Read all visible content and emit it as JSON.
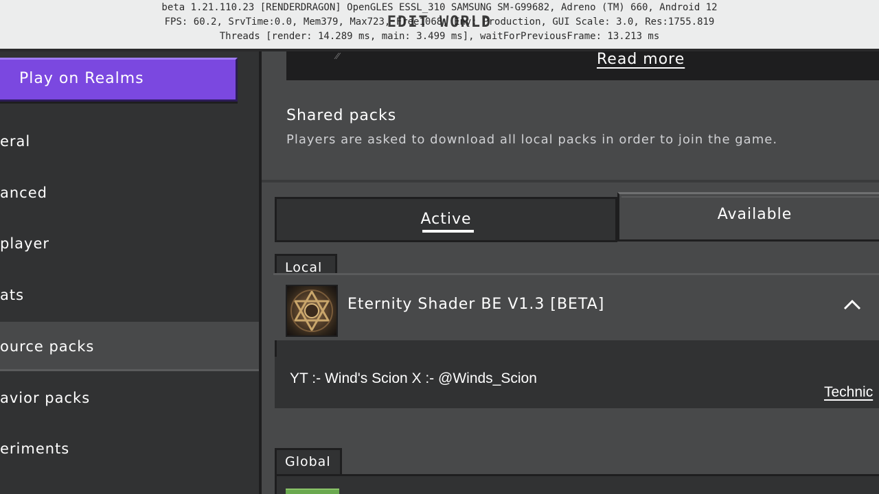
{
  "debug": {
    "line1": "beta 1.21.110.23 [RENDERDRAGON] OpenGLES ESSL_310 SAMSUNG SM-G99682, Adreno (TM) 660, Android 12",
    "line2": "FPS: 60.2, SrvTime:0.0, Mem379, Max723, Free1068, Env: Production, GUI Scale: 3.0, Res:1755.819",
    "line3": "Threads [render: 14.289 ms, main: 3.499 ms], waitForPreviousFrame: 13.213 ms",
    "title": "EDIT WORLD"
  },
  "sidebar": {
    "realms_button": "Play on Realms",
    "items": [
      {
        "label": "eral"
      },
      {
        "label": "anced"
      },
      {
        "label": "player"
      },
      {
        "label": "ats"
      },
      {
        "label": "ource packs",
        "active": true
      },
      {
        "label": "avior packs"
      },
      {
        "label": "eriments"
      }
    ]
  },
  "main": {
    "read_more": "Read more",
    "shared_packs": {
      "title": "Shared packs",
      "description": "Players are asked to download all local packs in order to join the game."
    },
    "tabs": [
      {
        "label": "Active",
        "selected": true
      },
      {
        "label": "Available",
        "selected": false
      }
    ],
    "local_label": "Local",
    "global_label": "Global",
    "pack": {
      "name": "Eternity Shader BE V1.3 [BETA]",
      "description": "YT :- Wind's Scion X :- @Winds_Scion",
      "link": "Technic"
    }
  },
  "colors": {
    "realms_purple": "#7b48e0",
    "panel_dark": "#313233",
    "panel_mid": "#48494a"
  }
}
